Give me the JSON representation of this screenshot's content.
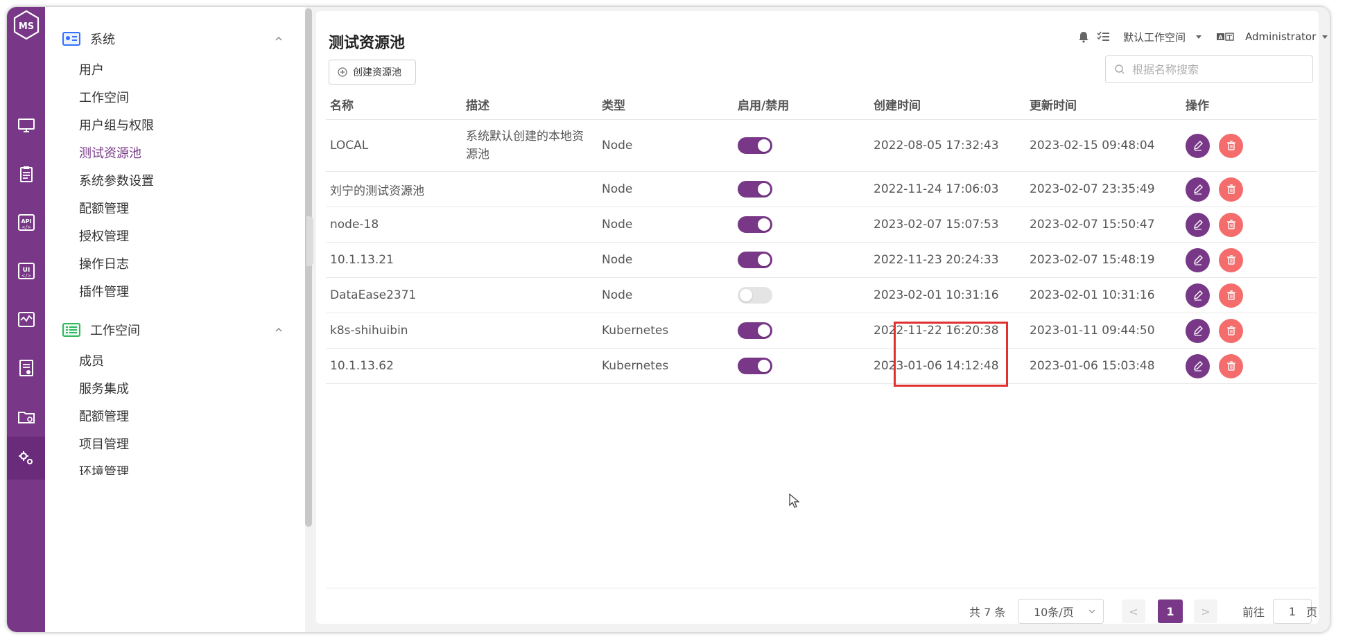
{
  "app": {
    "logo_text": "MS"
  },
  "rail": {
    "items": [
      {
        "icon": "monitor-icon"
      },
      {
        "icon": "clipboard-icon"
      },
      {
        "icon": "api-icon",
        "label": "API"
      },
      {
        "icon": "ui-icon",
        "label": "UI"
      },
      {
        "icon": "performance-icon"
      },
      {
        "icon": "report-icon"
      },
      {
        "icon": "folder-settings-icon"
      },
      {
        "icon": "settings-gears-icon",
        "active": true
      }
    ]
  },
  "menu": {
    "system": {
      "label": "系统",
      "items": [
        "用户",
        "工作空间",
        "用户组与权限",
        "测试资源池",
        "系统参数设置",
        "配额管理",
        "授权管理",
        "操作日志",
        "插件管理"
      ],
      "active": "测试资源池"
    },
    "workspace": {
      "label": "工作空间",
      "items": [
        "成员",
        "服务集成",
        "配额管理",
        "项目管理",
        "环境管理"
      ]
    }
  },
  "header": {
    "title": "测试资源池",
    "create_label": "创建资源池",
    "workspace_select": "默认工作空间",
    "user": "Administrator",
    "search_placeholder": "根据名称搜索"
  },
  "table": {
    "columns": [
      "名称",
      "描述",
      "类型",
      "启用/禁用",
      "创建时间",
      "更新时间",
      "操作"
    ],
    "rows": [
      {
        "name": "LOCAL",
        "description": "系统默认创建的本地资源池",
        "type": "Node",
        "enabled": true,
        "created": "2022-08-05 17:32:43",
        "updated": "2023-02-15 09:48:04"
      },
      {
        "name": "刘宁的测试资源池",
        "description": "",
        "type": "Node",
        "enabled": true,
        "created": "2022-11-24 17:06:03",
        "updated": "2023-02-07 23:35:49"
      },
      {
        "name": "node-18",
        "description": "",
        "type": "Node",
        "enabled": true,
        "created": "2023-02-07 15:07:53",
        "updated": "2023-02-07 15:50:47"
      },
      {
        "name": "10.1.13.21",
        "description": "",
        "type": "Node",
        "enabled": true,
        "created": "2022-11-23 20:24:33",
        "updated": "2023-02-07 15:48:19"
      },
      {
        "name": "DataEase2371",
        "description": "",
        "type": "Node",
        "enabled": false,
        "created": "2023-02-01 10:31:16",
        "updated": "2023-02-01 10:31:16"
      },
      {
        "name": "k8s-shihuibin",
        "description": "",
        "type": "Kubernetes",
        "enabled": true,
        "created": "2022-11-22 16:20:38",
        "updated": "2023-01-11 09:44:50"
      },
      {
        "name": "10.1.13.62",
        "description": "",
        "type": "Kubernetes",
        "enabled": true,
        "created": "2023-01-06 14:12:48",
        "updated": "2023-01-06 15:03:48"
      }
    ]
  },
  "pagination": {
    "total_text": "共 7 条",
    "page_size": "10条/页",
    "prev": "<",
    "current": "1",
    "next": ">",
    "goto_label": "前往",
    "goto_value": "1",
    "page_suffix": "页"
  },
  "colors": {
    "brand": "#783887",
    "danger": "#f56c6c",
    "highlight": "#e03131"
  }
}
